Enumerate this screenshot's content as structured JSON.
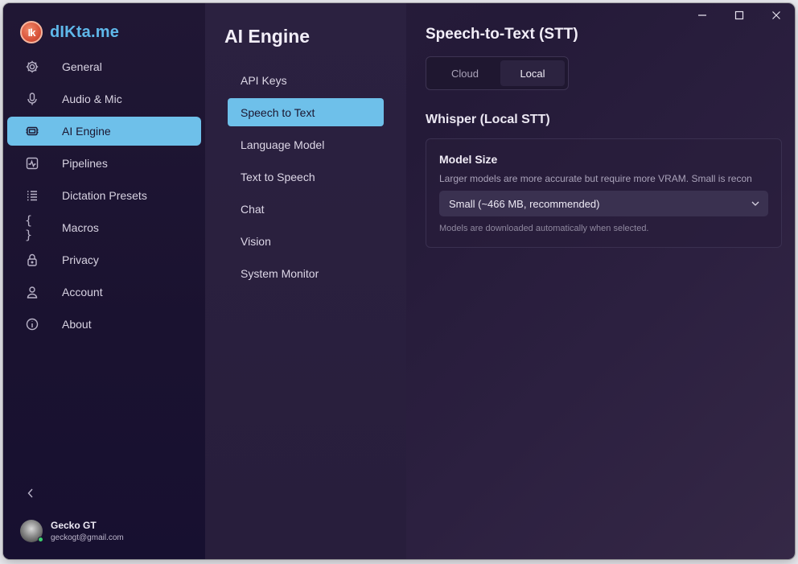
{
  "app": {
    "name": "dIKta.me",
    "logo_text": "Ik"
  },
  "sidebar": {
    "items": [
      {
        "label": "General",
        "icon": "gear-icon"
      },
      {
        "label": "Audio & Mic",
        "icon": "mic-icon"
      },
      {
        "label": "AI Engine",
        "icon": "chip-icon",
        "active": true
      },
      {
        "label": "Pipelines",
        "icon": "pulse-icon"
      },
      {
        "label": "Dictation Presets",
        "icon": "list-icon"
      },
      {
        "label": "Macros",
        "icon": "braces-icon"
      },
      {
        "label": "Privacy",
        "icon": "lock-icon"
      },
      {
        "label": "Account",
        "icon": "user-icon"
      },
      {
        "label": "About",
        "icon": "info-icon"
      }
    ],
    "braces_glyph": "{ }"
  },
  "user": {
    "name": "Gecko GT",
    "email": "geckogt@gmail.com"
  },
  "midpane": {
    "title": "AI Engine",
    "items": [
      {
        "label": "API Keys"
      },
      {
        "label": "Speech to Text",
        "active": true
      },
      {
        "label": "Language Model"
      },
      {
        "label": "Text to Speech"
      },
      {
        "label": "Chat"
      },
      {
        "label": "Vision"
      },
      {
        "label": "System Monitor"
      }
    ]
  },
  "content": {
    "title": "Speech-to-Text (STT)",
    "toggle": {
      "cloud": "Cloud",
      "local": "Local",
      "selected": "Local"
    },
    "section_title": "Whisper (Local STT)",
    "card": {
      "title": "Model Size",
      "description": "Larger models are more accurate but require more VRAM. Small is recon",
      "select_value": "Small (~466 MB, recommended)",
      "note": "Models are downloaded automatically when selected."
    }
  },
  "colors": {
    "accent": "#6ec0ea",
    "brand": "#5fb8ea",
    "online": "#3bd16f"
  }
}
